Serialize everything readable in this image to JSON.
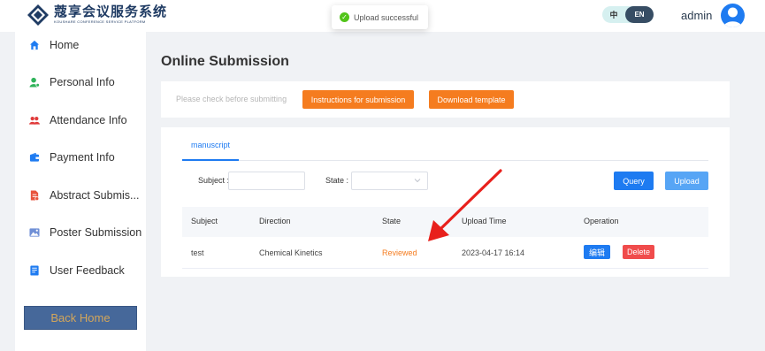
{
  "header": {
    "logo_cn": "蔻享会议服务系统",
    "logo_en": "KOUSHARE CONFERENCE SERVICE PLATFORM",
    "toast": "Upload successful",
    "lang_zh": "中",
    "lang_en": "EN",
    "username": "admin"
  },
  "sidebar": {
    "items": [
      {
        "label": "Home",
        "icon": "home-icon"
      },
      {
        "label": "Personal Info",
        "icon": "person-icon"
      },
      {
        "label": "Attendance Info",
        "icon": "people-icon"
      },
      {
        "label": "Payment Info",
        "icon": "wallet-icon"
      },
      {
        "label": "Abstract Submis...",
        "icon": "document-icon"
      },
      {
        "label": "Poster Submission",
        "icon": "image-icon"
      },
      {
        "label": "User Feedback",
        "icon": "feedback-icon"
      }
    ],
    "back_home": "Back Home"
  },
  "main": {
    "title": "Online Submission",
    "hint": "Please check before submitting",
    "instructions_btn": "Instructions for submission",
    "template_btn": "Download template",
    "tab": "manuscript",
    "filters": {
      "subject_label": "Subject :",
      "state_label": "State :",
      "subject_value": "",
      "state_value": ""
    },
    "query_btn": "Query",
    "upload_btn": "Upload",
    "table": {
      "headers": [
        "Subject",
        "Direction",
        "State",
        "Upload Time",
        "Operation"
      ],
      "rows": [
        {
          "subject": "test",
          "direction": "Chemical Kinetics",
          "state": "Reviewed",
          "upload_time": "2023-04-17 16:14",
          "edit": "编辑",
          "delete": "Delete"
        }
      ]
    }
  },
  "colors": {
    "accent_blue": "#1e7bf1",
    "orange": "#f57c1f",
    "delete_red": "#f04c4c",
    "annotation_arrow": "#e8201c"
  }
}
